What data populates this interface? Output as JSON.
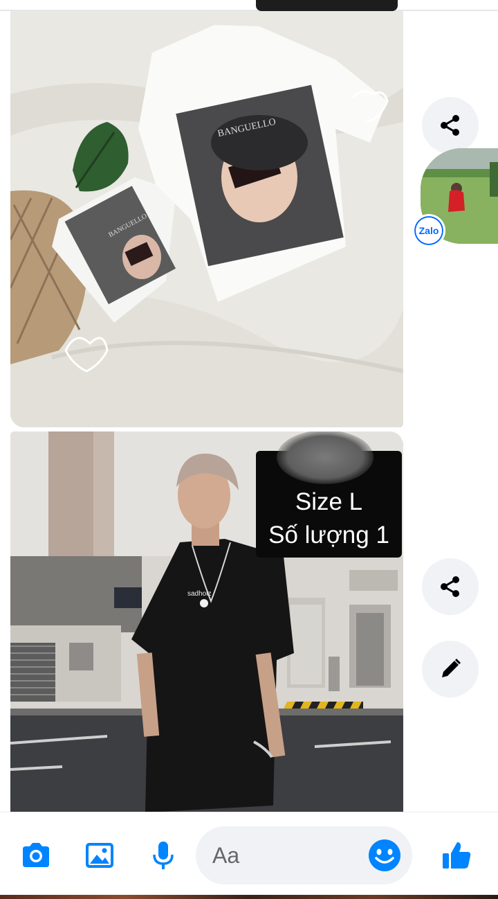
{
  "messages": [
    {
      "type": "photo",
      "icon": "tshirt-photo"
    },
    {
      "type": "photo",
      "icon": "model-photo",
      "caption": {
        "line1": "Size L",
        "line2": "Số lượng 1"
      }
    }
  ],
  "actions": {
    "share_icon": "share-icon",
    "edit_icon": "pencil-icon"
  },
  "chat_head": {
    "badge": "Zalo"
  },
  "composer": {
    "placeholder": "Aa",
    "icons": [
      "camera-icon",
      "image-icon",
      "microphone-icon",
      "emoji-icon",
      "thumbs-up-icon"
    ]
  },
  "colors": {
    "accent": "#0084ff",
    "zalo": "#0068ff",
    "button_bg": "#f0f2f5"
  }
}
